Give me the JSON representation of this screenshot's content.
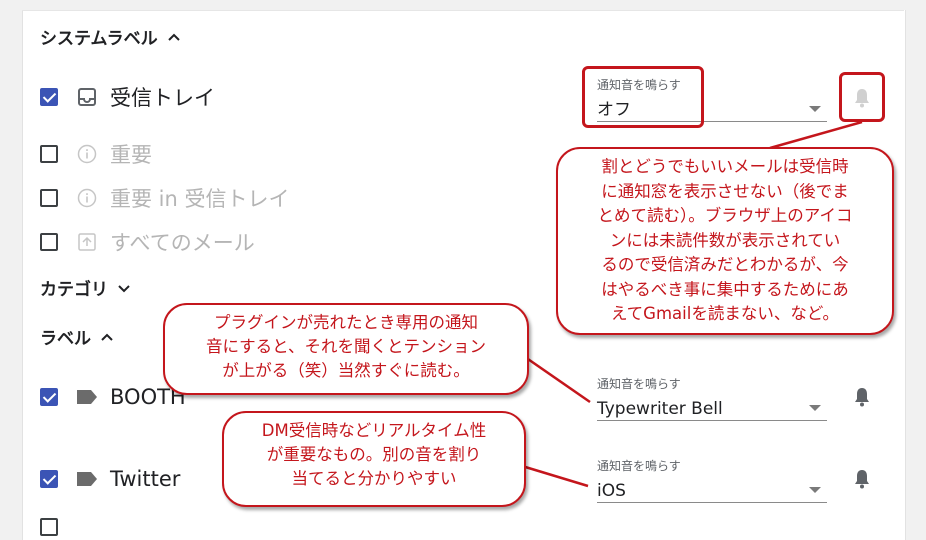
{
  "sections": {
    "system_label": "システムラベル",
    "category": "カテゴリ",
    "label": "ラベル"
  },
  "system_items": [
    {
      "label": "受信トレイ",
      "checked": true,
      "icon": "inbox-icon"
    },
    {
      "label": "重要",
      "checked": false,
      "icon": "info-icon"
    },
    {
      "label": "重要 in 受信トレイ",
      "checked": false,
      "icon": "info-icon"
    },
    {
      "label": "すべてのメール",
      "checked": false,
      "icon": "all-mail-icon"
    }
  ],
  "label_items": [
    {
      "label": "BOOTH",
      "checked": true,
      "icon": "label-tag-icon"
    },
    {
      "label": "Twitter",
      "checked": true,
      "icon": "label-tag-icon"
    }
  ],
  "sound_selects": {
    "inbox": {
      "caption": "通知音を鳴らす",
      "value": "オフ"
    },
    "booth": {
      "caption": "通知音を鳴らす",
      "value": "Typewriter Bell"
    },
    "twitter": {
      "caption": "通知音を鳴らす",
      "value": "iOS"
    }
  },
  "callouts": {
    "inbox": "割とどうでもいいメールは受信時\nに通知窓を表示させない（後でま\nとめて読む）。ブラウザ上のアイコ\nンには未読件数が表示されてい\nるので受信済みだとわかるが、今\nはやるべき事に集中するためにあ\nえてGmailを読まない、など。",
    "booth": "プラグインが売れたとき専用の通知\n音にすると、それを聞くとテンション\nが上がる（笑）当然すぐに読む。",
    "twitter": "DM受信時などリアルタイム性\nが重要なもの。別の音を割り\n当てると分かりやすい"
  },
  "colors": {
    "accent_red": "#c4161c",
    "checkbox_blue": "#3b54b5"
  }
}
